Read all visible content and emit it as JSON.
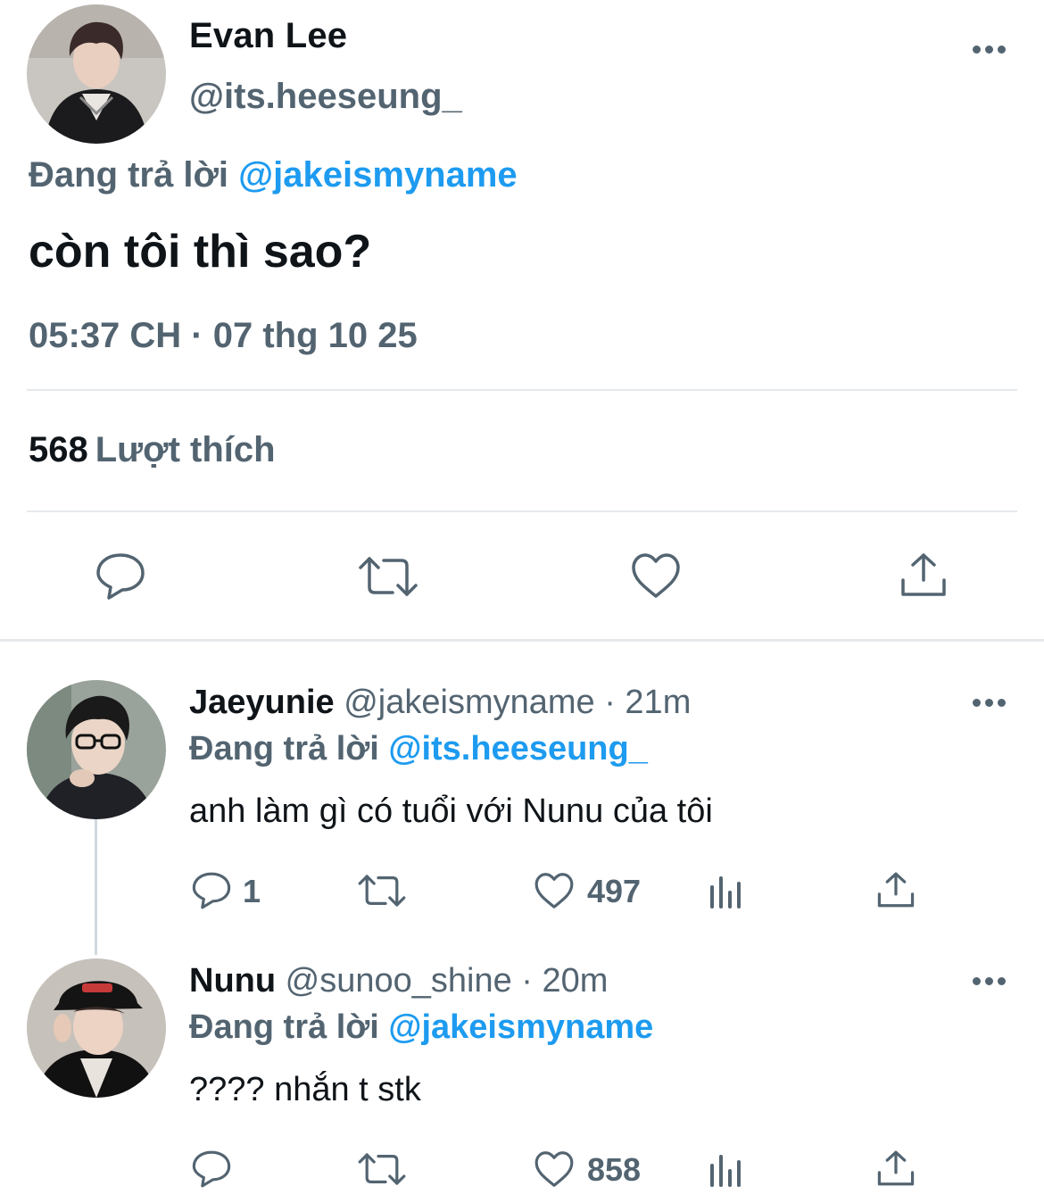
{
  "tweet": {
    "author_name": "Evan Lee",
    "author_handle": "@its.heeseung_",
    "replying_label": "Đang trả lời",
    "replying_to": "@jakeismyname",
    "text": "còn tôi thì sao?",
    "timestamp": "05:37 CH · 07 thg 10 25",
    "like_count": "568",
    "like_label": "Lượt thích"
  },
  "replies": [
    {
      "author_name": "Jaeyunie",
      "meta": "@jakeismyname · 21m",
      "replying_label": "Đang trả lời",
      "replying_to": "@its.heeseung_",
      "text": "anh làm gì có tuổi với Nunu của tôi",
      "reply_count": "1",
      "retweet_count": "",
      "like_count": "497"
    },
    {
      "author_name": "Nunu",
      "meta": "@sunoo_shine · 20m",
      "replying_label": "Đang trả lời",
      "replying_to": "@jakeismyname",
      "text": "???? nhắn t stk",
      "reply_count": "",
      "retweet_count": "",
      "like_count": "858"
    }
  ],
  "icons": {
    "reply": "comment-icon",
    "retweet": "retweet-icon",
    "like": "heart-icon",
    "views": "analytics-icon",
    "share": "share-icon",
    "more": "more-dots-icon"
  },
  "colors": {
    "text": "#0f1419",
    "secondary": "#536471",
    "link": "#1d9bf0",
    "divider": "#e6e9ec"
  }
}
